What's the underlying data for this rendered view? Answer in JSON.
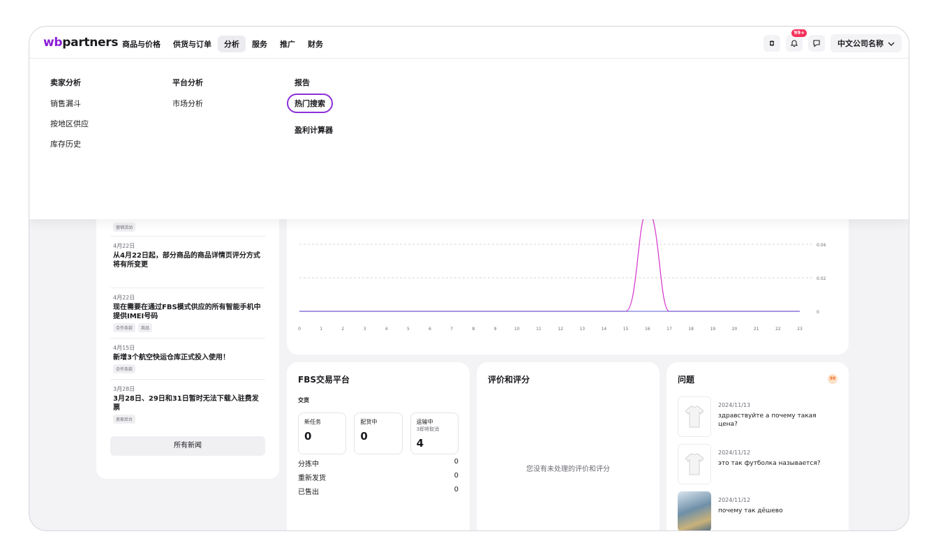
{
  "header": {
    "logo_wb": "wb",
    "logo_rest": "partners",
    "nav": [
      "商品与价格",
      "供货与订单",
      "分析",
      "服务",
      "推广",
      "财务"
    ],
    "notifications_badge": "99+",
    "company": "中文公司名称"
  },
  "menu": {
    "col1": {
      "head": "卖家分析",
      "items": [
        "销售漏斗",
        "按地区供应",
        "库存历史"
      ]
    },
    "col2": {
      "head": "平台分析",
      "items": [
        "市场分析"
      ]
    },
    "col3": {
      "head": "报告",
      "items": [
        "热门搜索",
        "盈利计算器"
      ],
      "highlighted": "热门搜索"
    }
  },
  "news": {
    "first_tag": "营销活动",
    "items": [
      {
        "date": "4月22日",
        "title": "从4月22日起，部分商品的商品详情页评分方式将有所变更",
        "tags": []
      },
      {
        "date": "4月22日",
        "title": "现在需要在通过FBS模式供应的所有智能手机中提供IMEI号码",
        "tags": [
          "合作条款",
          "商品"
        ]
      },
      {
        "date": "4月15日",
        "title": "新增3个航空快运仓库正式投入使用！",
        "tags": [
          "合作条款"
        ]
      },
      {
        "date": "3月28日",
        "title": "3月28日、29日和31日暂时无法下载入驻费发票",
        "tags": [
          "卖家后台"
        ]
      }
    ],
    "all_news": "所有新闻"
  },
  "chart_data": {
    "type": "line",
    "x": [
      0,
      1,
      2,
      3,
      4,
      5,
      6,
      7,
      8,
      9,
      10,
      11,
      12,
      13,
      14,
      15,
      16,
      17,
      18,
      19,
      20,
      21,
      22,
      23
    ],
    "series": [
      {
        "color": "#d63fd0",
        "values": [
          0,
          0,
          0,
          0,
          0,
          0,
          0,
          0,
          0,
          0,
          0,
          0,
          0,
          0,
          0,
          0,
          0.06,
          0,
          0,
          0,
          0,
          0,
          0,
          0
        ]
      },
      {
        "color": "#5b5bd6",
        "values": [
          0,
          0,
          0,
          0,
          0,
          0,
          0,
          0,
          0,
          0,
          0,
          0,
          0,
          0,
          0,
          0,
          0,
          0,
          0,
          0,
          0,
          0,
          0,
          0
        ]
      }
    ],
    "y_ticks": [
      "0",
      "0.02",
      "0.04"
    ],
    "ylim": [
      0,
      0.06
    ],
    "grid": true
  },
  "fbs": {
    "title": "FBS交易平台",
    "sub": "交货",
    "stats": [
      {
        "label": "新任务",
        "sub": "",
        "value": "0"
      },
      {
        "label": "配货中",
        "sub": "",
        "value": "0"
      },
      {
        "label": "运输中",
        "sub": "3即将取消",
        "value": "4"
      }
    ],
    "rows": [
      {
        "label": "分拣中",
        "value": "0"
      },
      {
        "label": "重新发货",
        "value": "0"
      },
      {
        "label": "已售出",
        "value": "0"
      }
    ]
  },
  "reviews": {
    "title": "评价和评分",
    "empty": "您没有未处理的评价和评分"
  },
  "questions": {
    "title": "问题",
    "badge": "99",
    "items": [
      {
        "date": "2024/11/13",
        "text": "здравствуйте а почему такая цена?",
        "thumb": "tshirt-icon"
      },
      {
        "date": "2024/11/12",
        "text": "это так футболка называется?",
        "thumb": "tshirt-icon"
      },
      {
        "date": "2024/11/12",
        "text": "почему так дёшево",
        "thumb": "product-image"
      }
    ]
  }
}
